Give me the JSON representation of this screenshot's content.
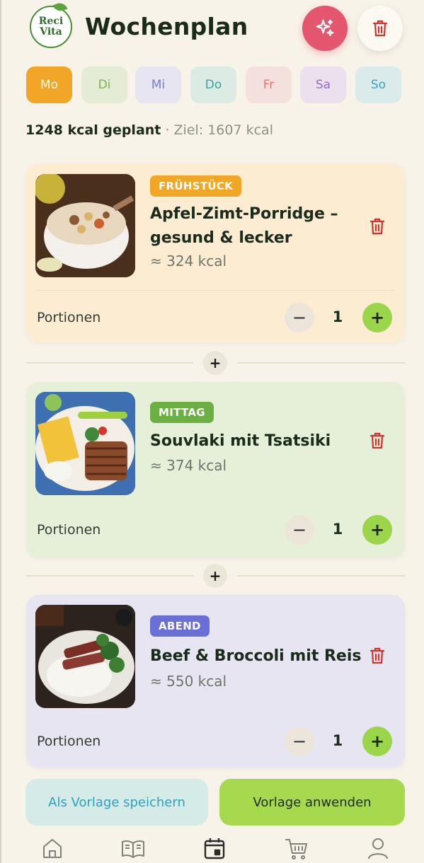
{
  "app": {
    "logo_text": [
      "Reci",
      "Vita"
    ],
    "title": "Wochenplan"
  },
  "header": {
    "ai_button": "sparkles-icon",
    "delete_button": "trash-icon"
  },
  "days": [
    {
      "label": "Mo",
      "bg": "#f2a626",
      "fg": "#ffffff",
      "selected": true
    },
    {
      "label": "Di",
      "bg": "#e4ecd6",
      "fg": "#7bb54a",
      "selected": false
    },
    {
      "label": "Mi",
      "bg": "#e6e5f1",
      "fg": "#7a7bd0",
      "selected": false
    },
    {
      "label": "Do",
      "bg": "#dcebe3",
      "fg": "#3aa1a0",
      "selected": false
    },
    {
      "label": "Fr",
      "bg": "#f4e0dc",
      "fg": "#e07a72",
      "selected": false
    },
    {
      "label": "Sa",
      "bg": "#ebe1ee",
      "fg": "#9a6bc4",
      "selected": false
    },
    {
      "label": "So",
      "bg": "#dbeaea",
      "fg": "#3e9fc4",
      "selected": false
    }
  ],
  "summary": {
    "planned": "1248 kcal geplant",
    "separator": "·",
    "goal": "Ziel: 1607 kcal"
  },
  "meals": [
    {
      "badge": "FRÜHSTÜCK",
      "badge_color": "#f2a626",
      "card_bg": "#fcecd2",
      "title": "Apfel-Zimt-Porridge – gesund & lecker",
      "kcal": "≈ 324 kcal",
      "portions_label": "Portionen",
      "portions": "1",
      "minus": "−",
      "plus": "+"
    },
    {
      "badge": "MITTAG",
      "badge_color": "#6cb043",
      "card_bg": "#e6f0d9",
      "title": "Souvlaki mit Tsatsiki",
      "kcal": "≈ 374 kcal",
      "portions_label": "Portionen",
      "portions": "1",
      "minus": "−",
      "plus": "+"
    },
    {
      "badge": "ABEND",
      "badge_color": "#6a6fd6",
      "card_bg": "#e6e5f1",
      "title": "Beef & Broccoli mit Reis",
      "kcal": "≈ 550 kcal",
      "portions_label": "Portionen",
      "portions": "1",
      "minus": "−",
      "plus": "+"
    }
  ],
  "add_meal": "+",
  "actions": {
    "save_template": "Als Vorlage speichern",
    "apply_template": "Vorlage anwenden"
  },
  "nav": [
    "home-icon",
    "book-icon",
    "calendar-icon",
    "cart-icon",
    "profile-icon"
  ],
  "nav_active": "calendar-icon"
}
